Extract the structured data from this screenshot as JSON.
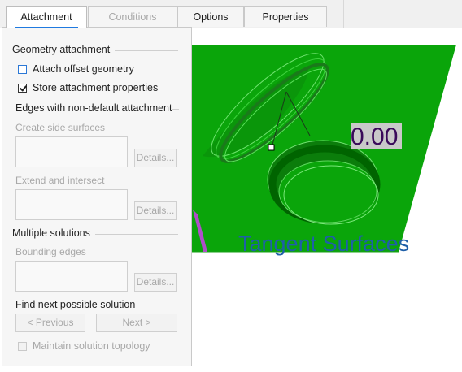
{
  "tabs": [
    {
      "label": "Attachment",
      "state": "active"
    },
    {
      "label": "Conditions",
      "state": "disabled"
    },
    {
      "label": "Options",
      "state": "normal"
    },
    {
      "label": "Properties",
      "state": "normal"
    }
  ],
  "panel": {
    "geometry_attachment": {
      "header": "Geometry attachment",
      "attach_offset_label": "Attach offset geometry",
      "attach_offset_checked": false,
      "store_props_label": "Store attachment properties",
      "store_props_checked": true
    },
    "edges": {
      "header": "Edges with non-default attachment",
      "create_side_label": "Create side surfaces",
      "create_side_details": "Details...",
      "extend_label": "Extend and intersect",
      "extend_details": "Details..."
    },
    "multiple": {
      "header": "Multiple solutions",
      "bounding_label": "Bounding edges",
      "bounding_details": "Details...",
      "find_next_label": "Find next possible solution",
      "previous_label": "< Previous",
      "next_label": "Next >",
      "maintain_label": "Maintain solution topology",
      "maintain_checked": false
    }
  },
  "graphics": {
    "dimension_value": "0.00",
    "annotation": "Tangent Surfaces",
    "colors": {
      "surface": "#0aa50a",
      "surface_dark": "#006400",
      "annotation_text": "#1f5fa8",
      "dimension_bg": "#c9c9c9",
      "dimension_text": "#3a0a5a",
      "arrow": "#b04fc9"
    }
  }
}
